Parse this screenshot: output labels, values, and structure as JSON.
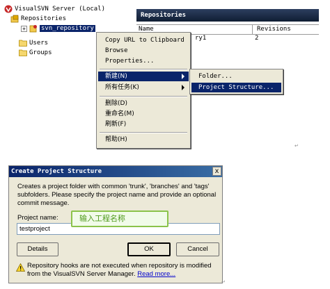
{
  "tree": {
    "server": "VisualSVN Server (Local)",
    "repositories": "Repositories",
    "repo_node": "svn_repository",
    "users": "Users",
    "groups": "Groups"
  },
  "panel": {
    "title": "Repositories",
    "col_name": "Name",
    "col_revisions": "Revisions",
    "row_name_fragment": "ry1",
    "row_revisions": "2"
  },
  "context_menu": {
    "copy_url": "Copy URL to Clipboard",
    "browse": "Browse",
    "properties": "Properties...",
    "new": "新建(N)",
    "all_tasks": "所有任务(K)",
    "delete": "删除(D)",
    "rename": "重命名(M)",
    "refresh": "刷新(F)",
    "help": "帮助(H)"
  },
  "submenu": {
    "folder": "Folder...",
    "project_structure": "Project Structure..."
  },
  "dialog": {
    "title": "Create Project Structure",
    "close_glyph": "x",
    "description": "Creates a project folder with common 'trunk', 'branches' and 'tags' subfolders. Please specify the project name and provide an optional commit message.",
    "label": "Project name:",
    "input_value": "testproject",
    "details_button": "Details",
    "ok_button": "OK",
    "cancel_button": "Cancel",
    "warning_text": "Repository hooks are not executed when repository is modified from the VisualSVN Server Manager.",
    "warning_link": "Read more..."
  },
  "callout": {
    "text": "输入工程名称"
  },
  "colors": {
    "highlight": "#0a246a",
    "menu_bg": "#ece9d8",
    "callout_border": "#8bc34a",
    "callout_text": "#4f9a1c"
  }
}
